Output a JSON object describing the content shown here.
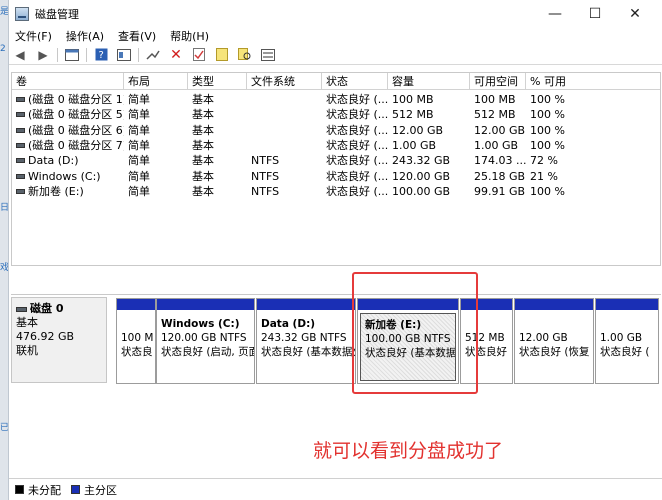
{
  "window": {
    "title": "磁盘管理",
    "minimize": "—",
    "maximize": "☐",
    "close": "✕"
  },
  "menu": [
    "文件(F)",
    "操作(A)",
    "查看(V)",
    "帮助(H)"
  ],
  "toolbar_icons": [
    "back-arrow-icon",
    "forward-arrow-icon",
    "console-icon",
    "help-icon",
    "properties-icon",
    "connect-icon",
    "delete-icon",
    "check-icon",
    "folder-icon",
    "search-icon",
    "window-icon"
  ],
  "columns": [
    "卷",
    "布局",
    "类型",
    "文件系统",
    "状态",
    "容量",
    "可用空间",
    "% 可用"
  ],
  "volumes": [
    [
      "(磁盘 0 磁盘分区 1)",
      "简单",
      "基本",
      "",
      "状态良好 (...",
      "100 MB",
      "100 MB",
      "100 %"
    ],
    [
      "(磁盘 0 磁盘分区 5)",
      "简单",
      "基本",
      "",
      "状态良好 (...",
      "512 MB",
      "512 MB",
      "100 %"
    ],
    [
      "(磁盘 0 磁盘分区 6)",
      "简单",
      "基本",
      "",
      "状态良好 (...",
      "12.00 GB",
      "12.00 GB",
      "100 %"
    ],
    [
      "(磁盘 0 磁盘分区 7)",
      "简单",
      "基本",
      "",
      "状态良好 (...",
      "1.00 GB",
      "1.00 GB",
      "100 %"
    ],
    [
      "Data (D:)",
      "简单",
      "基本",
      "NTFS",
      "状态良好 (...",
      "243.32 GB",
      "174.03 ...",
      "72 %"
    ],
    [
      "Windows (C:)",
      "简单",
      "基本",
      "NTFS",
      "状态良好 (...",
      "120.00 GB",
      "25.18 GB",
      "21 %"
    ],
    [
      "新加卷 (E:)",
      "简单",
      "基本",
      "NTFS",
      "状态良好 (...",
      "100.00 GB",
      "99.91 GB",
      "100 %"
    ]
  ],
  "disk": {
    "name": "磁盘 0",
    "type": "基本",
    "size": "476.92 GB",
    "status": "联机"
  },
  "partitions": [
    {
      "name": "",
      "size": "100 M",
      "status": "状态良"
    },
    {
      "name": "Windows (C:)",
      "size": "120.00 GB NTFS",
      "status": "状态良好 (启动, 页面"
    },
    {
      "name": "Data (D:)",
      "size": "243.32 GB NTFS",
      "status": "状态良好 (基本数据分"
    },
    {
      "name": "新加卷 (E:)",
      "size": "100.00 GB NTFS",
      "status": "状态良好 (基本数据"
    },
    {
      "name": "",
      "size": "512 MB",
      "status": "状态良好"
    },
    {
      "name": "",
      "size": "12.00 GB",
      "status": "状态良好 (恢复"
    },
    {
      "name": "",
      "size": "1.00 GB",
      "status": "状态良好 ("
    }
  ],
  "annotation": "就可以看到分盘成功了",
  "legend": [
    {
      "label": "未分配",
      "color": "#000000"
    },
    {
      "label": "主分区",
      "color": "#1a2fb5"
    }
  ]
}
